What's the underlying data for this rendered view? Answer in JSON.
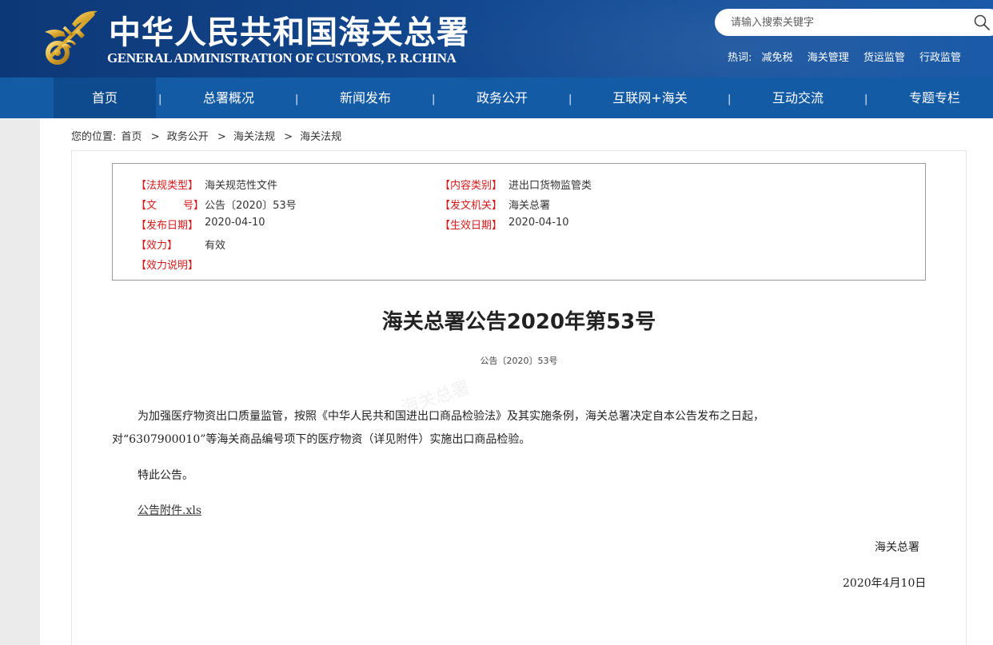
{
  "header": {
    "title": "中华人民共和国海关总署",
    "subtitle": "GENERAL ADMINISTRATION OF CUSTOMS, P. R.CHINA",
    "logo_icon": "customs-emblem-icon",
    "search": {
      "placeholder": "请输入搜索关键字",
      "icon": "search-icon"
    },
    "hotwords": {
      "label": "热词:",
      "items": [
        "减免税",
        "海关管理",
        "货运监管",
        "行政监管"
      ]
    },
    "colors": {
      "primary": "#13488f",
      "nav": "#145ba6",
      "accent_red": "#d41a1a"
    }
  },
  "nav": {
    "items": [
      "首页",
      "总署概况",
      "新闻发布",
      "政务公开",
      "互联网+海关",
      "互动交流",
      "专题专栏"
    ],
    "active": "首页",
    "separator": "|"
  },
  "breadcrumb": {
    "label": "您的位置:",
    "items": [
      "首页",
      "政务公开",
      "海关法规",
      "海关法规"
    ],
    "separator": ">"
  },
  "meta": {
    "regulation_type_key": "【法规类型】",
    "regulation_type_val": "海关规范性文件",
    "content_category_key": "【内容类别】",
    "content_category_val": "进出口货物监管类",
    "doc_number_key": "【文        号】",
    "doc_number_val": "公告〔2020〕53号",
    "issuing_authority_key": "【发文机关】",
    "issuing_authority_val": "海关总署",
    "publish_date_key": "【发布日期】",
    "publish_date_val": "2020-04-10",
    "effective_date_key": "【生效日期】",
    "effective_date_val": "2020-04-10",
    "validity_key": "【效力】",
    "validity_val": "有效",
    "validity_note_key": "【效力说明】"
  },
  "document": {
    "title": "海关总署公告2020年第53号",
    "number": "公告〔2020〕53号",
    "paragraph1_line1": "为加强医疗物资出口质量监管，按照《中华人民共和国进出口商品检验法》及其实施条例，海关总署决定自本公告发布之日起，",
    "paragraph1_line2": "对“6307900010”等海关商品编号项下的医疗物资（详见附件）实施出口商品检验。",
    "paragraph2": "特此公告。",
    "attachment": "公告附件.xls",
    "signature": "海关总署",
    "date": "2020年4月10日"
  }
}
